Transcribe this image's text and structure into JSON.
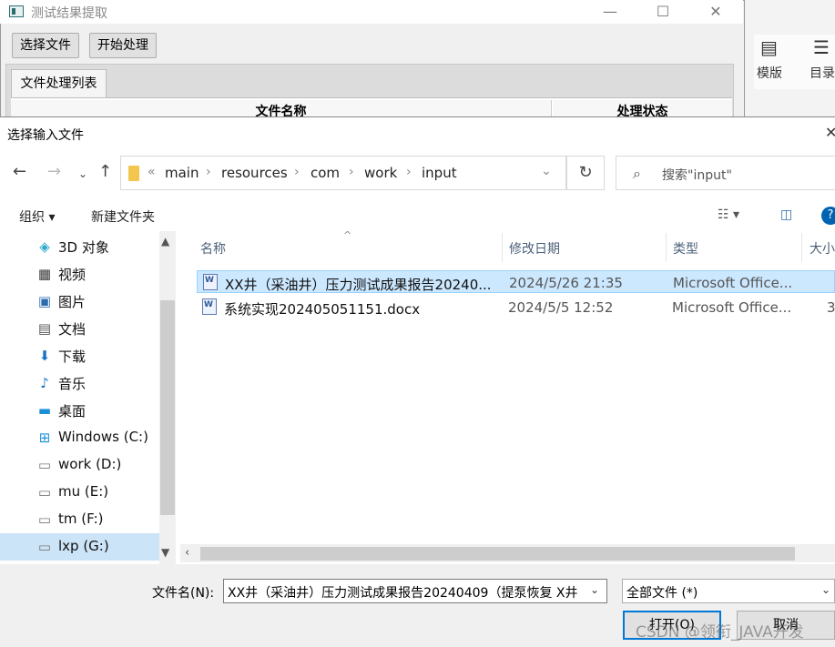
{
  "bg_app": {
    "title": "测试结果提取",
    "minimize": "—",
    "maximize": "☐",
    "close": "✕",
    "buttons": {
      "select_file": "选择文件",
      "start_process": "开始处理"
    },
    "tab": "文件处理列表",
    "columns": {
      "file_name": "文件名称",
      "status": "处理状态"
    }
  },
  "right_app": {
    "item1": "模版",
    "item2": "目录"
  },
  "dialog": {
    "title": "选择输入文件",
    "breadcrumb": [
      "main",
      "resources",
      "com",
      "work",
      "input"
    ],
    "breadcrumb_prefix": "«",
    "search_placeholder": "搜索\"input\"",
    "toolbar": {
      "organize": "组织 ▾",
      "new_folder": "新建文件夹"
    },
    "nav_items": [
      {
        "label": "3D 对象",
        "icon": "3d-objects-icon"
      },
      {
        "label": "视频",
        "icon": "video-icon"
      },
      {
        "label": "图片",
        "icon": "pictures-icon"
      },
      {
        "label": "文档",
        "icon": "documents-icon"
      },
      {
        "label": "下载",
        "icon": "download-icon"
      },
      {
        "label": "音乐",
        "icon": "music-icon"
      },
      {
        "label": "桌面",
        "icon": "desktop-icon"
      },
      {
        "label": "Windows (C:)",
        "icon": "windows-drive-icon"
      },
      {
        "label": "work (D:)",
        "icon": "drive-icon"
      },
      {
        "label": "mu (E:)",
        "icon": "drive-icon"
      },
      {
        "label": "tm (F:)",
        "icon": "drive-icon"
      },
      {
        "label": "lxp (G:)",
        "icon": "drive-icon",
        "selected": true
      }
    ],
    "columns": {
      "name": "名称",
      "modified": "修改日期",
      "type": "类型",
      "size": "大小"
    },
    "files": [
      {
        "name": "XX井（采油井）压力测试成果报告20240...",
        "modified": "2024/5/26 21:35",
        "type": "Microsoft Office...",
        "size": "",
        "selected": true
      },
      {
        "name": "系统实现202405051151.docx",
        "modified": "2024/5/5 12:52",
        "type": "Microsoft Office...",
        "size": "3"
      }
    ],
    "filename_label": "文件名(N):",
    "filename_value": "XX井（采油井）压力测试成果报告20240409（提泵恢复 X井",
    "filetype_value": "全部文件 (*)",
    "open_button": "打开(O)",
    "cancel_button": "取消"
  },
  "watermark": "CSDN @领衔_JAVA开发",
  "colors": {
    "accent": "#0078d7",
    "selection": "#cce8ff",
    "nav_selection": "#cce4f7"
  }
}
